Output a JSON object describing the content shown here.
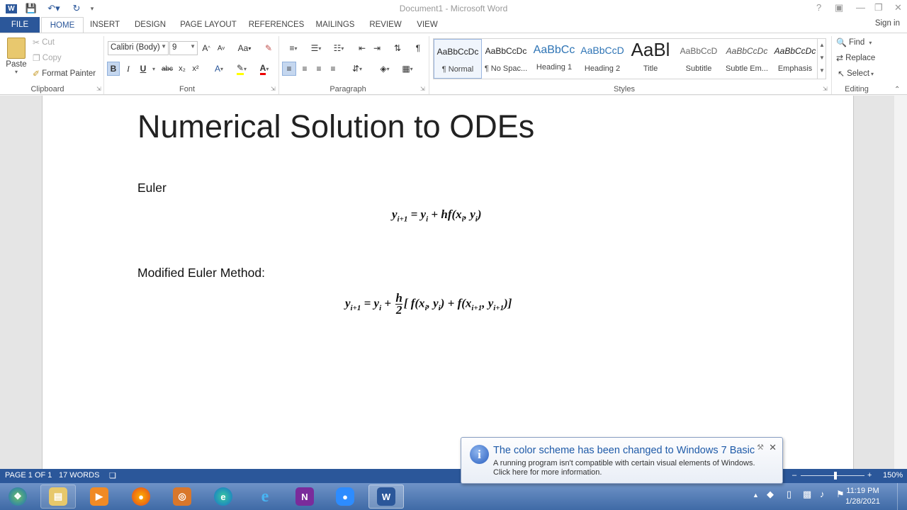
{
  "window": {
    "title": "Document1 - Microsoft Word",
    "signin": "Sign in"
  },
  "tabs": [
    "FILE",
    "HOME",
    "INSERT",
    "DESIGN",
    "PAGE LAYOUT",
    "REFERENCES",
    "MAILINGS",
    "REVIEW",
    "VIEW"
  ],
  "clipboard": {
    "paste": "Paste",
    "cut": "Cut",
    "copy": "Copy",
    "format_painter": "Format Painter",
    "label": "Clipboard"
  },
  "font": {
    "name": "Calibri (Body)",
    "size": "9",
    "label": "Font",
    "grow": "A",
    "shrink": "A",
    "case": "Aa",
    "bold": "B",
    "italic": "I",
    "underline": "U",
    "strike": "abc",
    "sub": "x₂",
    "sup": "x²"
  },
  "paragraph": {
    "label": "Paragraph"
  },
  "styles": {
    "label": "Styles",
    "items": [
      {
        "preview": "AaBbCcDc",
        "name": "¶ Normal"
      },
      {
        "preview": "AaBbCcDc",
        "name": "¶ No Spac..."
      },
      {
        "preview": "AaBbCc",
        "name": "Heading 1"
      },
      {
        "preview": "AaBbCcD",
        "name": "Heading 2"
      },
      {
        "preview": "AaBl",
        "name": "Title"
      },
      {
        "preview": "AaBbCcD",
        "name": "Subtitle"
      },
      {
        "preview": "AaBbCcDc",
        "name": "Subtle Em..."
      },
      {
        "preview": "AaBbCcDc",
        "name": "Emphasis"
      }
    ]
  },
  "editing": {
    "find": "Find",
    "replace": "Replace",
    "select": "Select",
    "label": "Editing"
  },
  "document": {
    "heading": "Numerical Solution to ODEs",
    "section1": "Euler",
    "section2": "Modified Euler Method:"
  },
  "status": {
    "page": "PAGE 1 OF 1",
    "words": "17 WORDS",
    "zoom": "150%"
  },
  "notification": {
    "title": "The color scheme has been changed to Windows 7 Basic",
    "line1": "A running program isn't compatible with certain visual elements of Windows.",
    "line2": "Click here for more information."
  },
  "clock": {
    "time": "11:19 PM",
    "date": "1/28/2021"
  },
  "colors": {
    "accent": "#2b579a",
    "taskbar": "#4f79b4"
  }
}
